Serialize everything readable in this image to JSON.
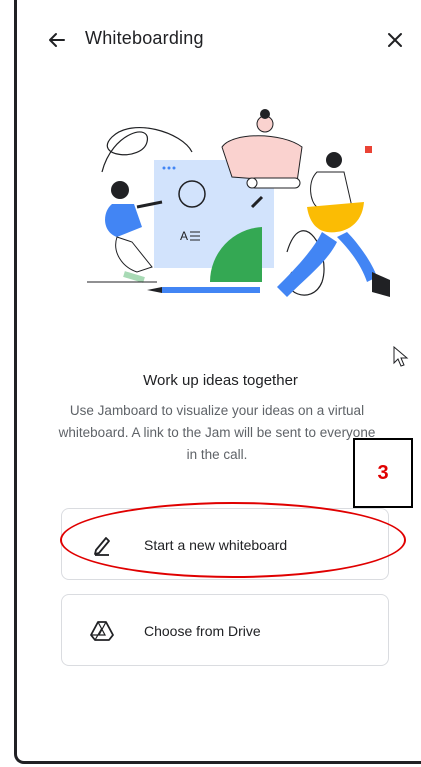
{
  "header": {
    "back_icon": "arrow-left-icon",
    "title": "Whiteboarding",
    "close_icon": "close-icon"
  },
  "content": {
    "headline": "Work up ideas together",
    "description": "Use Jamboard to visualize your ideas on a virtual whiteboard. A link to the Jam will be sent to everyone in the call."
  },
  "options": [
    {
      "label": "Start a new whiteboard",
      "icon": "pen-icon"
    },
    {
      "label": "Choose from Drive",
      "icon": "google-drive-icon"
    }
  ],
  "annotation": {
    "step_number": "3",
    "color": "#e00000"
  },
  "colors": {
    "text_primary": "#202124",
    "text_secondary": "#5f6368",
    "border": "#dadce0",
    "illustration_blue": "#4285f4",
    "illustration_green": "#34a853",
    "illustration_yellow": "#fbbc04",
    "illustration_red": "#ea4335"
  }
}
